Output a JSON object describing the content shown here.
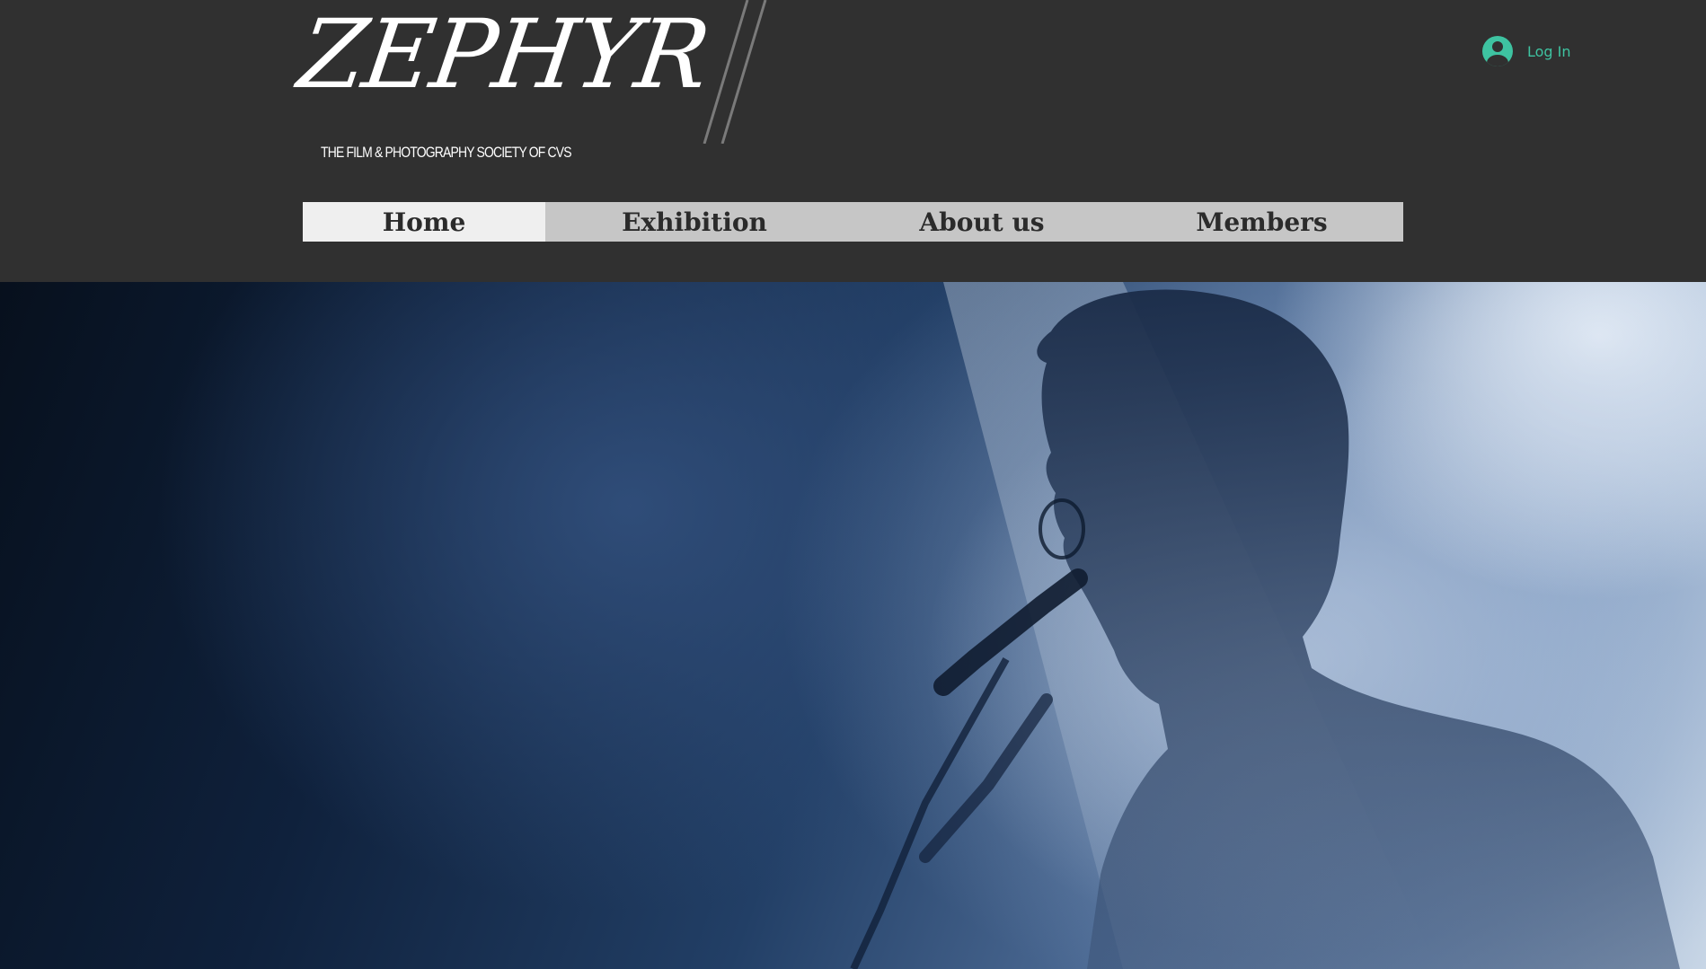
{
  "header": {
    "logo_text": "ZEPHYR",
    "tagline": "THE FILM & PHOTOGRAPHY SOCIETY OF CVS"
  },
  "login": {
    "label": "Log In",
    "icon": "user-avatar-icon"
  },
  "nav": {
    "items": [
      {
        "label": "Home",
        "active": true
      },
      {
        "label": "Exhibition",
        "active": false
      },
      {
        "label": "About us",
        "active": false
      },
      {
        "label": "Members",
        "active": false
      }
    ]
  },
  "colors": {
    "background": "#303030",
    "accent": "#3ec3a1",
    "nav_bg": "#c6c6c6",
    "nav_active_bg": "#efefef",
    "nav_text": "#2b2b2b"
  }
}
